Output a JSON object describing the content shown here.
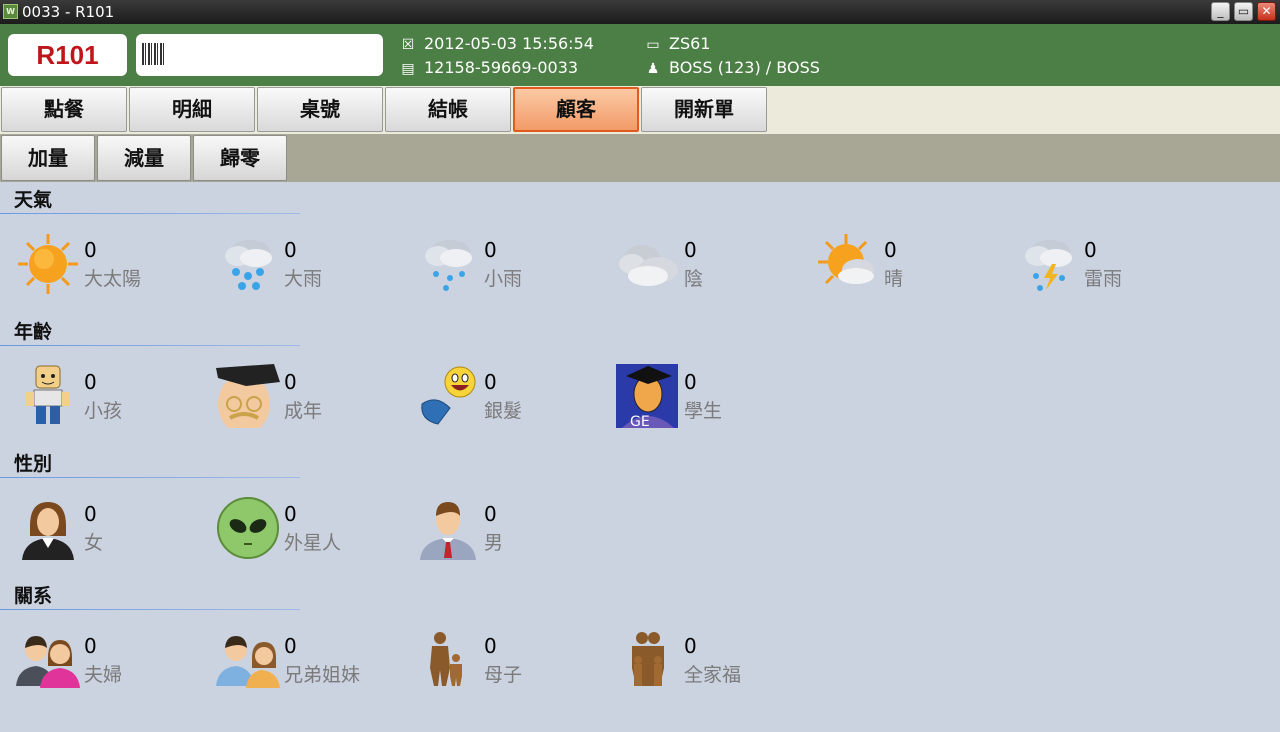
{
  "window": {
    "title": "0033 - R101",
    "app_icon": "W",
    "min": "_",
    "max": "▭",
    "close": "✕"
  },
  "header": {
    "table": "R101",
    "datetime": "2012-05-03 15:56:54",
    "order_no": "12158-59669-0033",
    "terminal": "ZS61",
    "user": "BOSS (123) / BOSS"
  },
  "tabs": [
    {
      "label": "點餐"
    },
    {
      "label": "明細"
    },
    {
      "label": "桌號"
    },
    {
      "label": "結帳"
    },
    {
      "label": "顧客",
      "active": true
    },
    {
      "label": "開新單"
    }
  ],
  "qty_buttons": [
    {
      "label": "加量"
    },
    {
      "label": "減量"
    },
    {
      "label": "歸零"
    }
  ],
  "sections": [
    {
      "title": "天氣",
      "items": [
        {
          "label": "大太陽",
          "count": "0",
          "icon": "sun-icon"
        },
        {
          "label": "大雨",
          "count": "0",
          "icon": "heavy-rain-icon"
        },
        {
          "label": "小雨",
          "count": "0",
          "icon": "light-rain-icon"
        },
        {
          "label": "陰",
          "count": "0",
          "icon": "cloudy-icon"
        },
        {
          "label": "晴",
          "count": "0",
          "icon": "partly-sunny-icon"
        },
        {
          "label": "雷雨",
          "count": "0",
          "icon": "thunderstorm-icon"
        }
      ]
    },
    {
      "title": "年齡",
      "items": [
        {
          "label": "小孩",
          "count": "0",
          "icon": "child-icon"
        },
        {
          "label": "成年",
          "count": "0",
          "icon": "adult-icon"
        },
        {
          "label": "銀髮",
          "count": "0",
          "icon": "senior-icon"
        },
        {
          "label": "學生",
          "count": "0",
          "icon": "student-icon",
          "icon_text": "GE"
        }
      ]
    },
    {
      "title": "性別",
      "items": [
        {
          "label": "女",
          "count": "0",
          "icon": "female-icon"
        },
        {
          "label": "外星人",
          "count": "0",
          "icon": "alien-icon"
        },
        {
          "label": "男",
          "count": "0",
          "icon": "male-icon"
        }
      ]
    },
    {
      "title": "關系",
      "items": [
        {
          "label": "夫婦",
          "count": "0",
          "icon": "couple-icon"
        },
        {
          "label": "兄弟姐妹",
          "count": "0",
          "icon": "siblings-icon"
        },
        {
          "label": "母子",
          "count": "0",
          "icon": "mother-child-icon"
        },
        {
          "label": "全家福",
          "count": "0",
          "icon": "family-icon"
        }
      ]
    }
  ],
  "colors": {
    "header_green": "#4c7f45",
    "active_tab": "#f29b68",
    "table_red": "#c0161b",
    "content_bg": "#cbd2e0"
  }
}
